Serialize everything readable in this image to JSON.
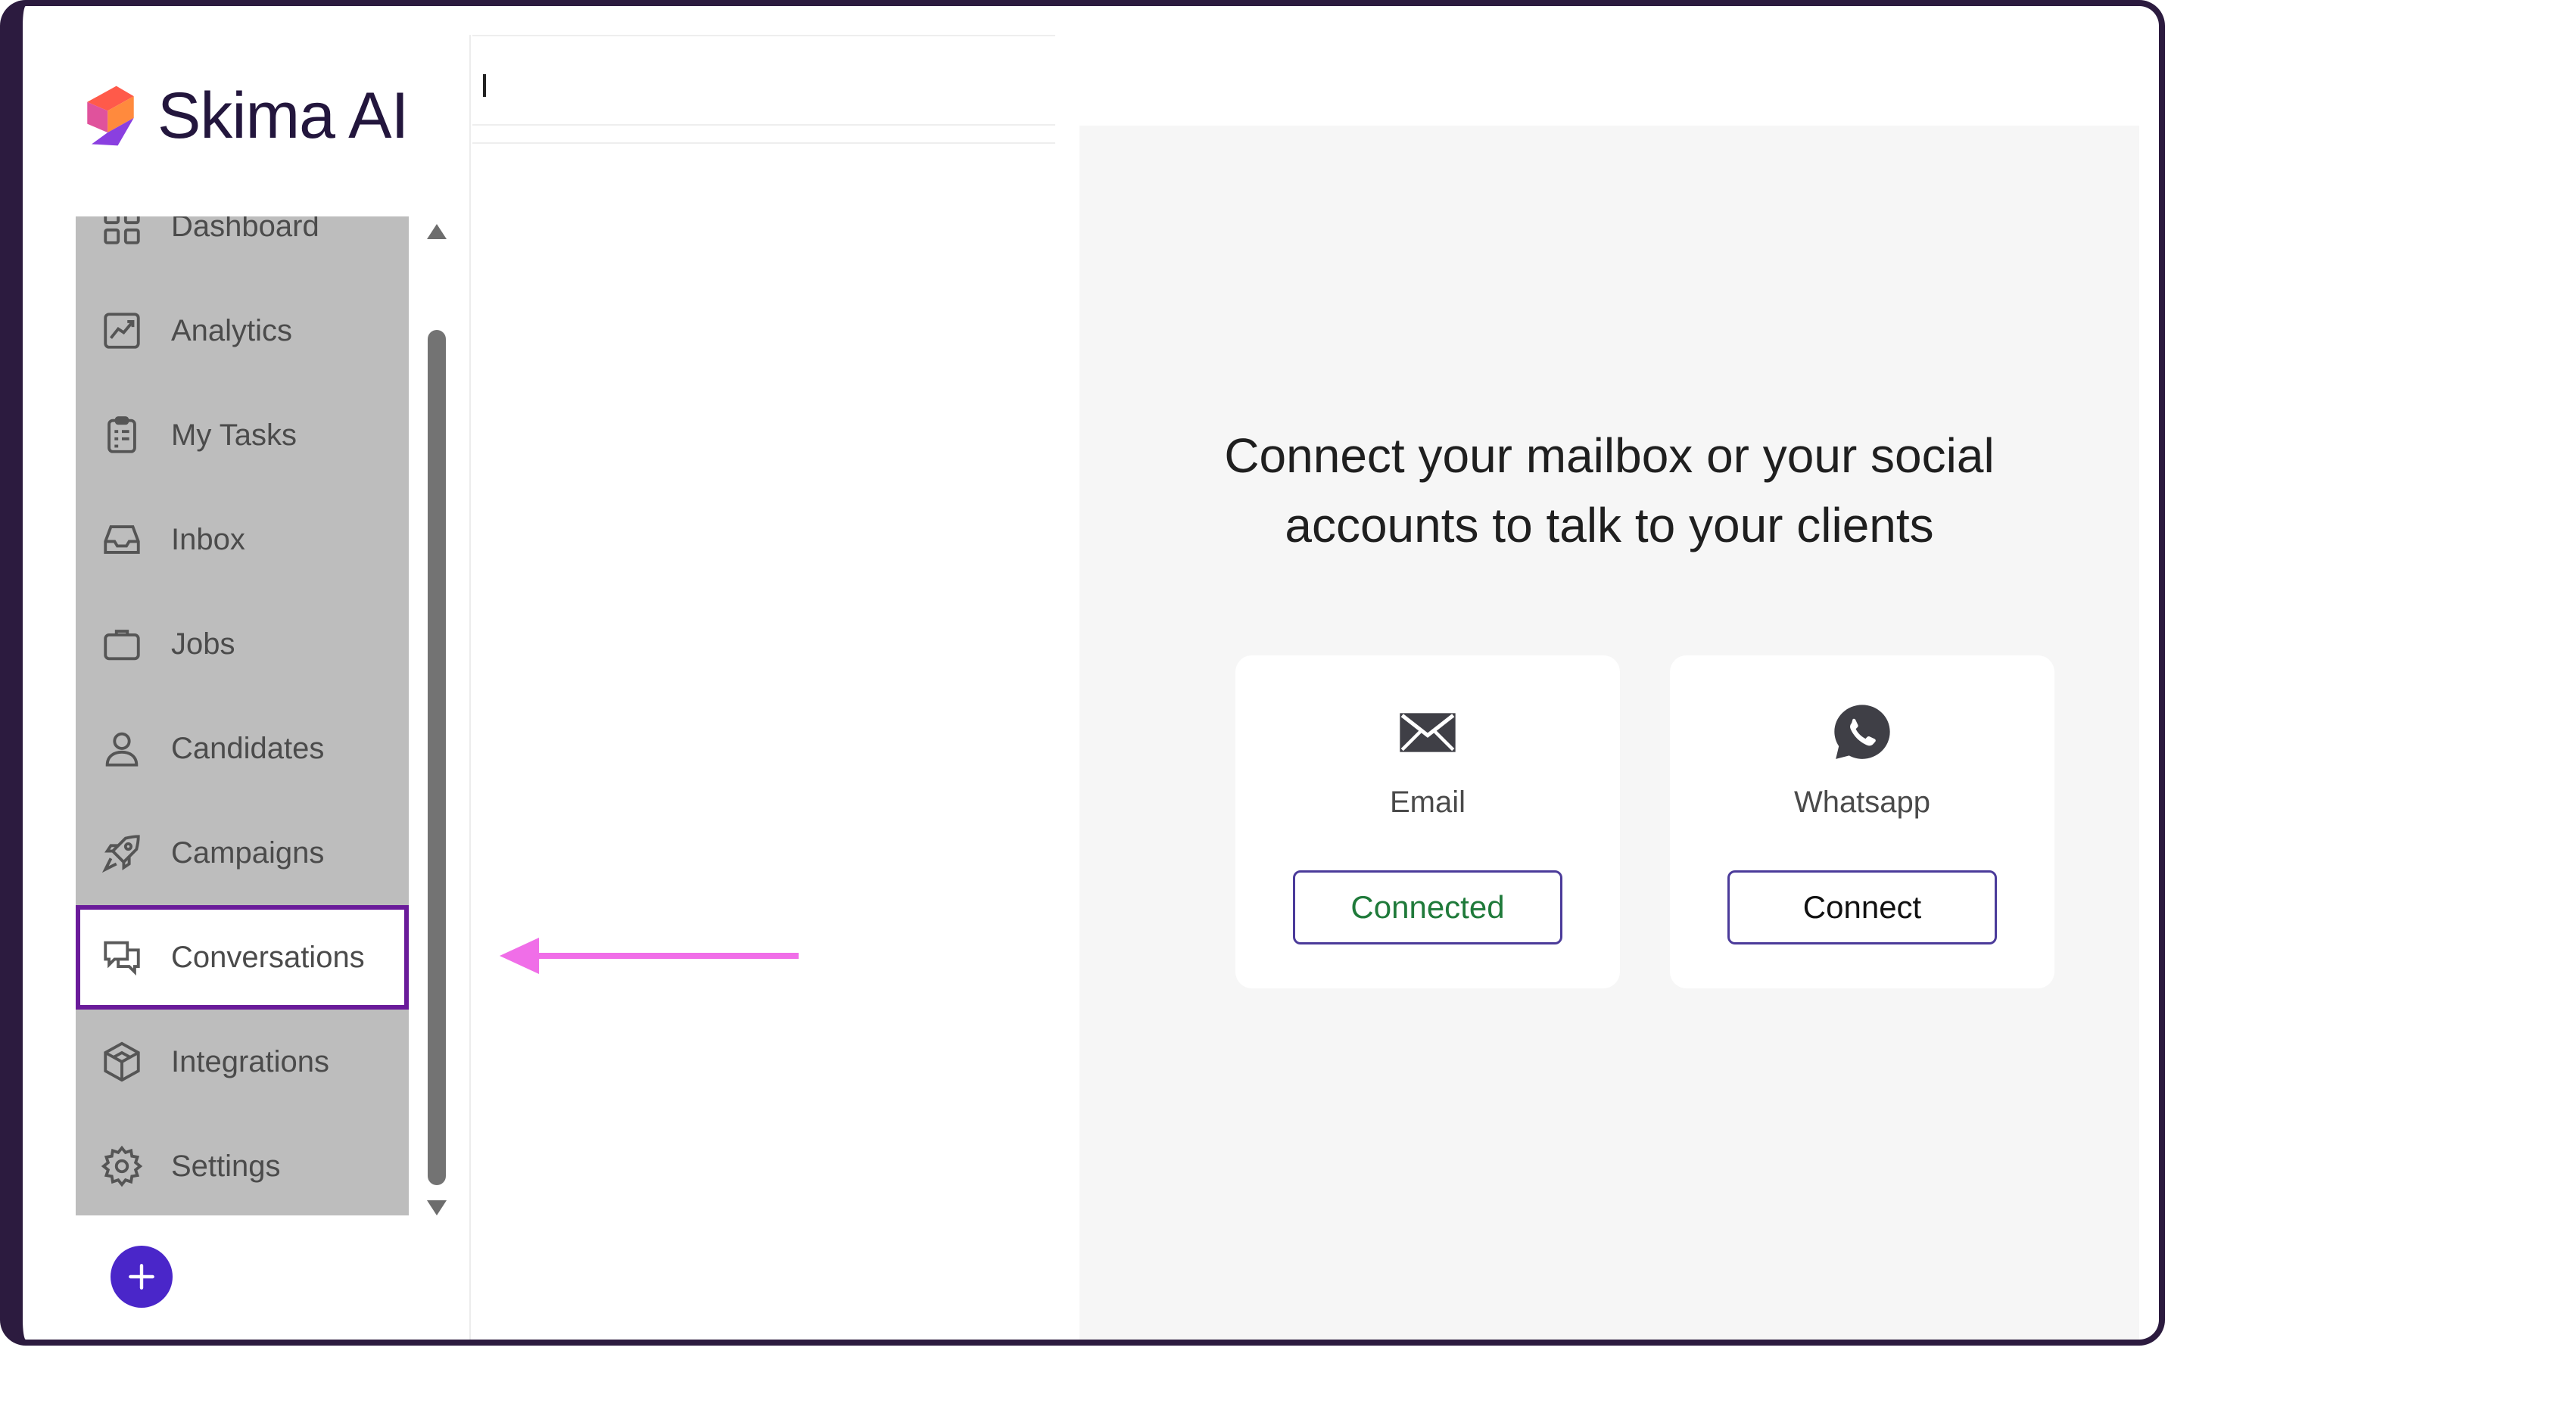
{
  "app": {
    "brand_name": "Skima AI"
  },
  "sidebar": {
    "items": [
      {
        "label": "Dashboard",
        "icon": "dashboard-icon"
      },
      {
        "label": "Analytics",
        "icon": "analytics-icon"
      },
      {
        "label": "My Tasks",
        "icon": "clipboard-icon"
      },
      {
        "label": "Inbox",
        "icon": "inbox-icon"
      },
      {
        "label": "Jobs",
        "icon": "briefcase-icon"
      },
      {
        "label": "Candidates",
        "icon": "person-icon"
      },
      {
        "label": "Campaigns",
        "icon": "rocket-icon"
      },
      {
        "label": "Conversations",
        "icon": "chat-bubbles-icon",
        "active": true
      },
      {
        "label": "Integrations",
        "icon": "cube-icon"
      },
      {
        "label": "Settings",
        "icon": "gear-icon"
      }
    ],
    "add_button_icon": "plus-icon"
  },
  "main": {
    "heading": "Connect your mailbox or your social accounts to talk to your clients",
    "channels": [
      {
        "label": "Email",
        "icon": "envelope-icon",
        "button_label": "Connected",
        "status": "connected"
      },
      {
        "label": "Whatsapp",
        "icon": "whatsapp-icon",
        "button_label": "Connect",
        "status": "disconnected"
      }
    ]
  },
  "colors": {
    "frame": "#2c1b3f",
    "nav_background": "#bdbdbd",
    "active_outline": "#6a1b9a",
    "add_button": "#4a26c9",
    "connected_text": "#1f7a3a",
    "button_border": "#4b3b9a",
    "annotation_arrow": "#f06ee8"
  }
}
